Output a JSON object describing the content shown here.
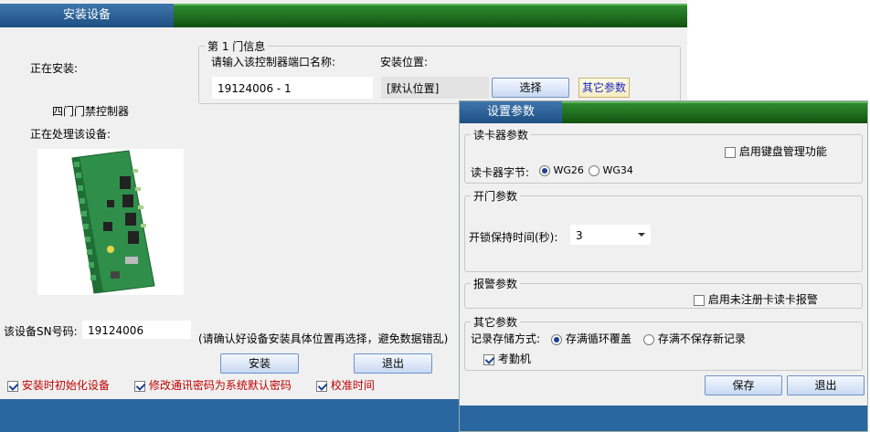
{
  "main": {
    "title": "安装设备",
    "installing_label": "正在安装:",
    "device_name": "四门门禁控制器",
    "processing_label": "正在处理该设备:",
    "door_group": {
      "legend": "第 1 门信息",
      "port_name_label": "请输入该控制器端口名称:",
      "port_name_value": "19124006 - 1",
      "location_label": "安装位置:",
      "location_value": "[默认位置]",
      "select_button": "选择",
      "other_params_button": "其它参数"
    },
    "sn_label": "该设备SN号码:",
    "sn_value": "19124006",
    "hint": "(请确认好设备安装具体位置再选择，避免数据错乱)",
    "install_button": "安装",
    "exit_button": "退出",
    "checkboxes": [
      {
        "label": "安装时初始化设备",
        "checked": true
      },
      {
        "label": "修改通讯密码为系统默认密码",
        "checked": true
      },
      {
        "label": "校准时间",
        "checked": true
      }
    ]
  },
  "dialog": {
    "title": "设置参数",
    "reader_group": {
      "legend": "读卡器参数",
      "keyboard_mgmt_label": "启用键盘管理功能",
      "keyboard_mgmt_checked": false,
      "byte_label": "读卡器字节:",
      "options": [
        "WG26",
        "WG34"
      ],
      "selected": "WG26"
    },
    "door_group": {
      "legend": "开门参数",
      "hold_time_label": "开锁保持时间(秒):",
      "hold_time_value": "3"
    },
    "alarm_group": {
      "legend": "报警参数",
      "unregistered_alarm_label": "启用未注册卡读卡报警",
      "unregistered_alarm_checked": false
    },
    "other_group": {
      "legend": "其它参数",
      "storage_label": "记录存储方式:",
      "storage_options": [
        "存满循环覆盖",
        "存满不保存新记录"
      ],
      "storage_selected": "存满循环覆盖",
      "attendance_label": "考勤机",
      "attendance_checked": true
    },
    "save_button": "保存",
    "exit_button": "退出"
  },
  "colors": {
    "title_blue": "#2a67a0",
    "title_green": "#1f6d1f",
    "window_bg": "#f0f0f0",
    "warning_red": "#c00000",
    "link_blue": "#1b27c8"
  }
}
